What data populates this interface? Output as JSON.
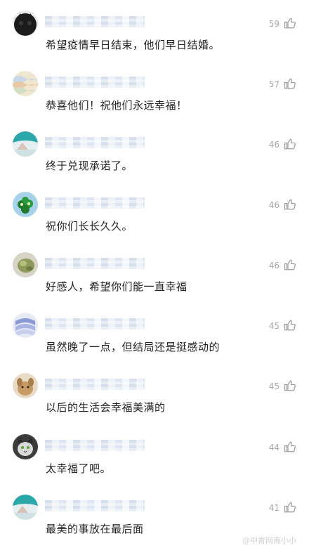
{
  "comments": [
    {
      "avatar": "dark-cat",
      "likes": "59",
      "text": "希望疫情早日结束，他们早日结婚。"
    },
    {
      "avatar": "pastel-wave",
      "likes": "57",
      "text": "恭喜他们！祝他们永远幸福！"
    },
    {
      "avatar": "teal-landscape",
      "likes": "46",
      "text": "终于兑现承诺了。"
    },
    {
      "avatar": "green-cartoon",
      "likes": "46",
      "text": "祝你们长长久久。"
    },
    {
      "avatar": "plant-photo",
      "likes": "46",
      "text": "好感人，希望你们能一直幸福"
    },
    {
      "avatar": "blue-abstract",
      "likes": "45",
      "text": "虽然晚了一点，但结局还是挺感动的"
    },
    {
      "avatar": "dog-photo",
      "likes": "45",
      "text": "以后的生活会幸福美满的"
    },
    {
      "avatar": "cat-photo",
      "likes": "44",
      "text": "太幸福了吧。"
    },
    {
      "avatar": "teal-landscape",
      "likes": "41",
      "text": "最美的事放在最后面"
    }
  ],
  "watermark": "@中青网南小小"
}
